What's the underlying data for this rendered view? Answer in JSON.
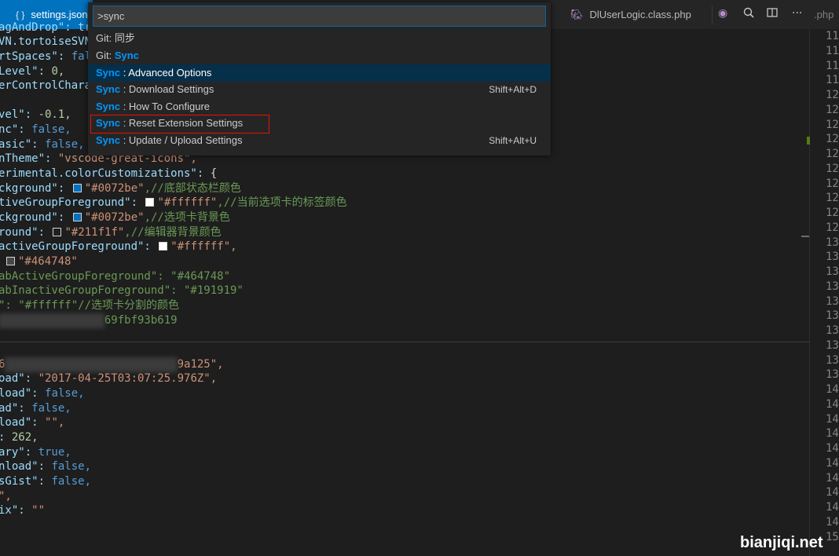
{
  "tabs": {
    "active_icon": "{ }",
    "active_label": "settings.json",
    "second_label": "DlUserLogic.class.php",
    "third_label": ".php"
  },
  "toolbar_icons": [
    "php-elephant-icon",
    "open-changes-icon",
    "split-editor-icon",
    "more-actions-icon"
  ],
  "quick_open": {
    "query": ">sync",
    "items": [
      {
        "prefix": "Git: ",
        "label": "同步",
        "shortcut": ""
      },
      {
        "prefix": "Git: ",
        "label": "Sync",
        "shortcut": ""
      },
      {
        "prefix": "Sync",
        "label": " : Advanced Options",
        "shortcut": ""
      },
      {
        "prefix": "Sync",
        "label": " : Download Settings",
        "shortcut": "Shift+Alt+D"
      },
      {
        "prefix": "Sync",
        "label": " : How To Configure",
        "shortcut": ""
      },
      {
        "prefix": "Sync",
        "label": " : Reset Extension Settings",
        "shortcut": ""
      },
      {
        "prefix": "Sync",
        "label": " : Update / Upload Settings",
        "shortcut": "Shift+Alt+U"
      }
    ]
  },
  "code": {
    "l0": "agAndDrop\": tr",
    "l1": "VN.tortoiseSVN",
    "l2k": "rtSpaces\": ",
    "l2v": "fal",
    "l3k": "Level\": ",
    "l3v": "0,",
    "l4k": "erControlChara",
    "l5k": "vel\": ",
    "l5v": "-0.1,",
    "l6k": "nc\": ",
    "l6v": "false,",
    "l7k": "asic\": ",
    "l7v": "false,",
    "l8k": "nTheme\": ",
    "l8v": "\"vscode-great-icons\",",
    "l9k": "erimental.colorCustomizations\": ",
    "l9v": "{",
    "l10k": "ckground\": ",
    "l10v": "\"#0072be\"",
    "l10c": ",//底部状态栏颜色",
    "l11k": "tiveGroupForeground\": ",
    "l11v": "\"#ffffff\"",
    "l11c": ",//当前选项卡的标签颜色",
    "l12k": "ckground\": ",
    "l12v": "\"#0072be\"",
    "l12c": ",//选项卡背景色",
    "l13k": "round\": ",
    "l13v": "\"#211f1f\"",
    "l13c": ",//编辑器背景颜色",
    "l14k": "activeGroupForeground\": ",
    "l14v": "\"#ffffff\",",
    "l15v": "\"#464748\"",
    "l16": "abActiveGroupForeground\": \"#464748\"",
    "l17": "abInactiveGroupForeground\": \"#191919\"",
    "l18": "\": \"#ffffff\"//选项卡分割的颜色",
    "l19": "69fbf93b619",
    "l20a": "6",
    "l20b": "9a125\",",
    "l21k": "oad\": ",
    "l21v": "\"2017-04-25T03:07:25.976Z\",",
    "l22k": "load\": ",
    "l22v": "false,",
    "l23k": "ad\": ",
    "l23v": "false,",
    "l24k": "load\": ",
    "l24v": "\"\",",
    "l25k": ": ",
    "l25v": "262,",
    "l26k": "ary\": ",
    "l26v": "true,",
    "l27k": "nload\": ",
    "l27v": "false,",
    "l28k": "sGist\": ",
    "l28v": "false,",
    "l29": "\",",
    "l30k": "ix\": ",
    "l30v": "\"\""
  },
  "line_numbers": [
    "11",
    "11",
    "11",
    "11",
    "12",
    "12",
    "12",
    "12",
    "12",
    "12",
    "12",
    "12",
    "12",
    "12",
    "13",
    "13",
    "13",
    "13",
    "13",
    "13",
    "13",
    "13",
    "13",
    "13",
    "14",
    "14",
    "14",
    "14",
    "14",
    "14",
    "14",
    "14",
    "14",
    "14",
    "15"
  ],
  "watermark": "bianjiqi.net",
  "colors": {
    "accent": "#0072be",
    "highlight": "#0097fb",
    "selection": "#062f4a",
    "red_box": "#e51400"
  }
}
